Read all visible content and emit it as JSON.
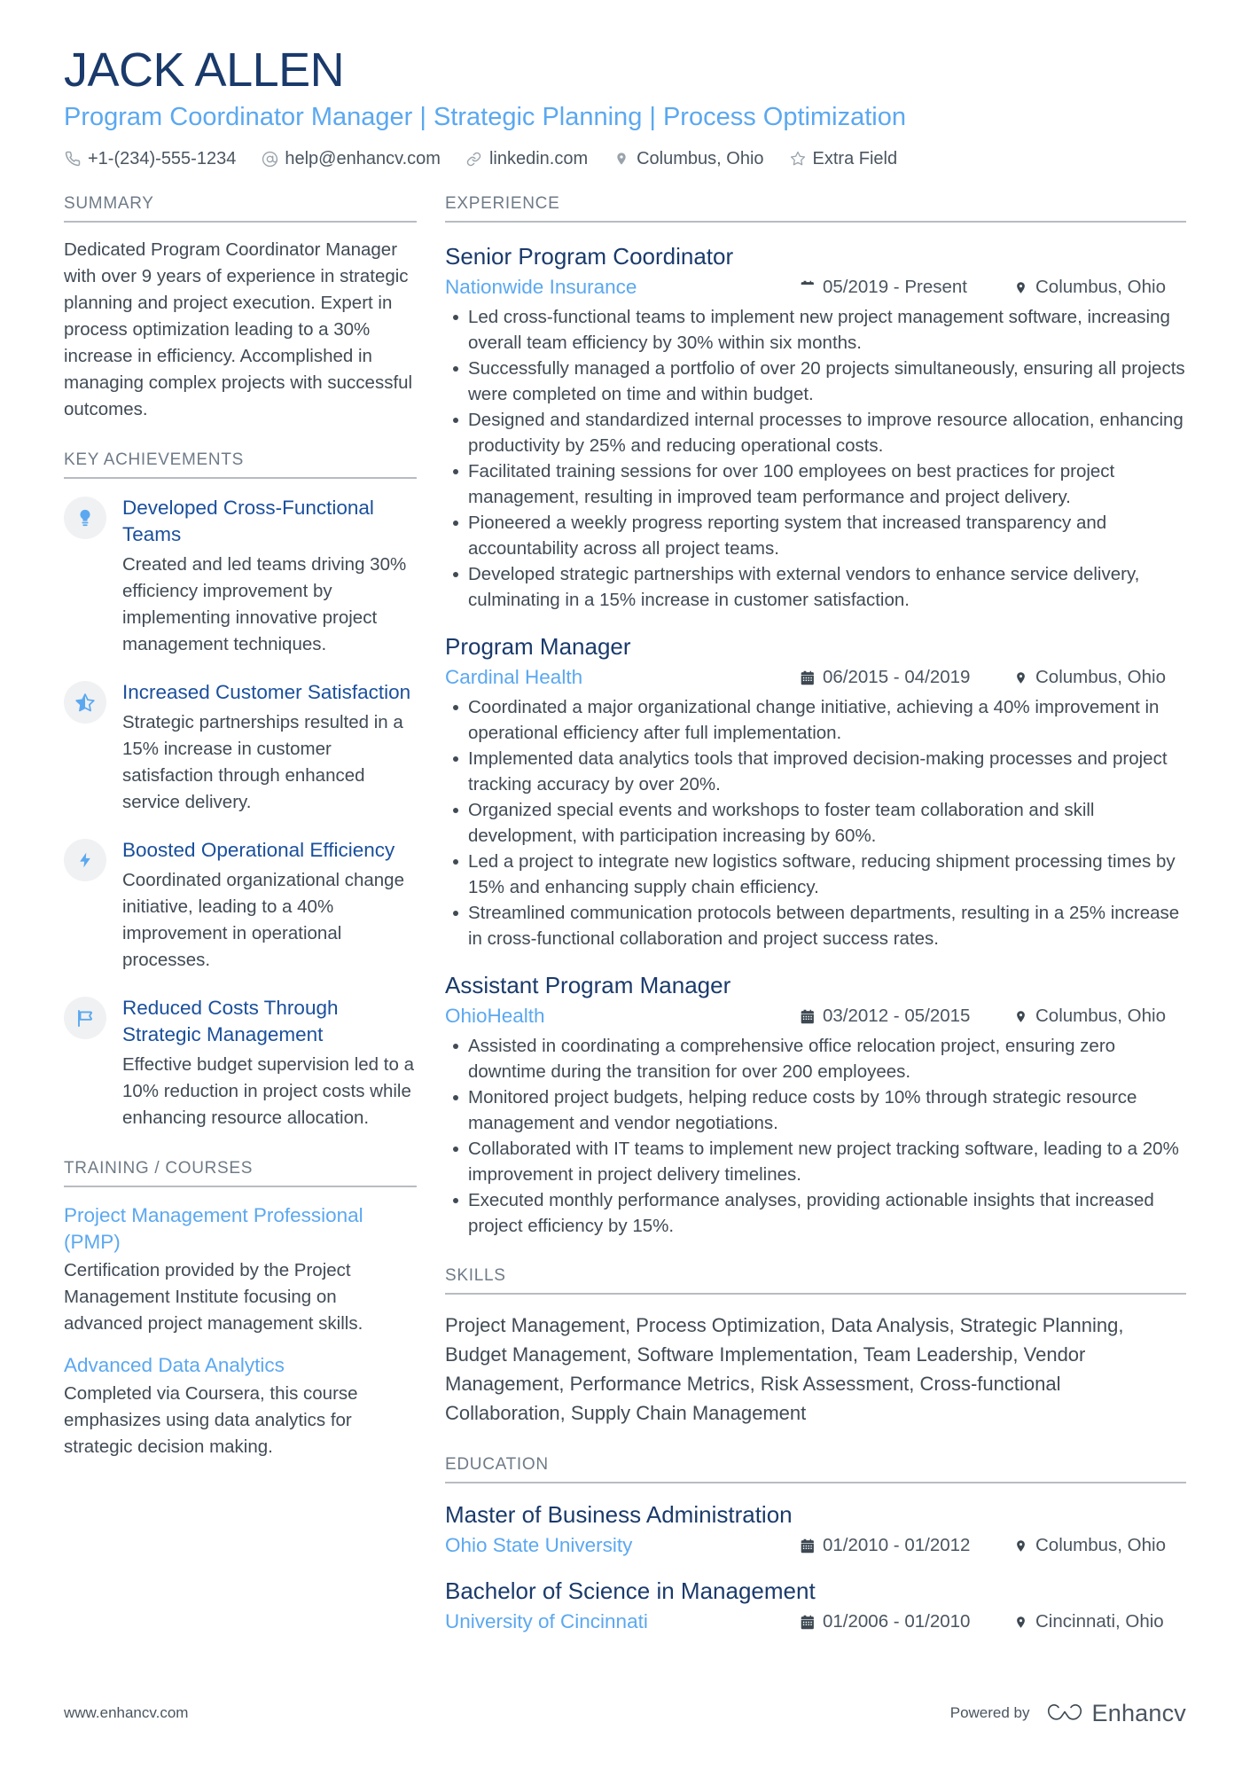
{
  "header": {
    "name": "JACK ALLEN",
    "headline": "Program Coordinator Manager | Strategic Planning | Process Optimization",
    "contacts": [
      {
        "icon": "phone-icon",
        "text": "+1-(234)-555-1234"
      },
      {
        "icon": "email-icon",
        "text": "help@enhancv.com"
      },
      {
        "icon": "link-icon",
        "text": "linkedin.com"
      },
      {
        "icon": "location-pin-icon",
        "text": "Columbus, Ohio"
      },
      {
        "icon": "star-icon",
        "text": "Extra Field"
      }
    ]
  },
  "sidebar": {
    "summary": {
      "title": "SUMMARY",
      "text": "Dedicated Program Coordinator Manager with over 9 years of experience in strategic planning and project execution. Expert in process optimization leading to a 30% increase in efficiency. Accomplished in managing complex projects with successful outcomes."
    },
    "achievements": {
      "title": "KEY ACHIEVEMENTS",
      "items": [
        {
          "icon": "lightbulb-icon",
          "title": "Developed Cross-Functional Teams",
          "desc": "Created and led teams driving 30% efficiency improvement by implementing innovative project management techniques."
        },
        {
          "icon": "star-half-icon",
          "title": "Increased Customer Satisfaction",
          "desc": "Strategic partnerships resulted in a 15% increase in customer satisfaction through enhanced service delivery."
        },
        {
          "icon": "lightning-bolt-icon",
          "title": "Boosted Operational Efficiency",
          "desc": "Coordinated organizational change initiative, leading to a 40% improvement in operational processes."
        },
        {
          "icon": "flag-icon",
          "title": "Reduced Costs Through Strategic Management",
          "desc": "Effective budget supervision led to a 10% reduction in project costs while enhancing resource allocation."
        }
      ]
    },
    "training": {
      "title": "TRAINING / COURSES",
      "items": [
        {
          "title": "Project Management Professional (PMP)",
          "desc": "Certification provided by the Project Management Institute focusing on advanced project management skills."
        },
        {
          "title": "Advanced Data Analytics",
          "desc": "Completed via Coursera, this course emphasizes using data analytics for strategic decision making."
        }
      ]
    }
  },
  "main": {
    "experience": {
      "title": "EXPERIENCE",
      "jobs": [
        {
          "title": "Senior Program Coordinator",
          "company": "Nationwide Insurance",
          "date": "05/2019 - Present",
          "location": "Columbus, Ohio",
          "bullets": [
            "Led cross-functional teams to implement new project management software, increasing overall team efficiency by 30% within six months.",
            "Successfully managed a portfolio of over 20 projects simultaneously, ensuring all projects were completed on time and within budget.",
            "Designed and standardized internal processes to improve resource allocation, enhancing productivity by 25% and reducing operational costs.",
            "Facilitated training sessions for over 100 employees on best practices for project management, resulting in improved team performance and project delivery.",
            "Pioneered a weekly progress reporting system that increased transparency and accountability across all project teams.",
            "Developed strategic partnerships with external vendors to enhance service delivery, culminating in a 15% increase in customer satisfaction."
          ]
        },
        {
          "title": "Program Manager",
          "company": "Cardinal Health",
          "date": "06/2015 - 04/2019",
          "location": "Columbus, Ohio",
          "bullets": [
            "Coordinated a major organizational change initiative, achieving a 40% improvement in operational efficiency after full implementation.",
            "Implemented data analytics tools that improved decision-making processes and project tracking accuracy by over 20%.",
            "Organized special events and workshops to foster team collaboration and skill development, with participation increasing by 60%.",
            "Led a project to integrate new logistics software, reducing shipment processing times by 15% and enhancing supply chain efficiency.",
            "Streamlined communication protocols between departments, resulting in a 25% increase in cross-functional collaboration and project success rates."
          ]
        },
        {
          "title": "Assistant Program Manager",
          "company": "OhioHealth",
          "date": "03/2012 - 05/2015",
          "location": "Columbus, Ohio",
          "bullets": [
            "Assisted in coordinating a comprehensive office relocation project, ensuring zero downtime during the transition for over 200 employees.",
            "Monitored project budgets, helping reduce costs by 10% through strategic resource management and vendor negotiations.",
            "Collaborated with IT teams to implement new project tracking software, leading to a 20% improvement in project delivery timelines.",
            "Executed monthly performance analyses, providing actionable insights that increased project efficiency by 15%."
          ]
        }
      ]
    },
    "skills": {
      "title": "SKILLS",
      "text": "Project Management, Process Optimization, Data Analysis, Strategic Planning, Budget Management, Software Implementation, Team Leadership, Vendor Management, Performance Metrics, Risk Assessment, Cross-functional Collaboration, Supply Chain Management"
    },
    "education": {
      "title": "EDUCATION",
      "items": [
        {
          "degree": "Master of Business Administration",
          "school": "Ohio State University",
          "date": "01/2010 - 01/2012",
          "location": "Columbus, Ohio"
        },
        {
          "degree": "Bachelor of Science in Management",
          "school": "University of Cincinnati",
          "date": "01/2006 - 01/2010",
          "location": "Cincinnati, Ohio"
        }
      ]
    }
  },
  "footer": {
    "url": "www.enhancv.com",
    "powered_by": "Powered by",
    "brand": "Enhancv"
  },
  "colors": {
    "name_navy": "#1a3a6b",
    "accent_blue": "#5ba8f0",
    "achievement_title": "#1a4f9c",
    "body_text": "#414b55",
    "section_label": "#6f7b87",
    "rule": "#b7bcc2",
    "bubble_bg": "#f0f1f2"
  }
}
